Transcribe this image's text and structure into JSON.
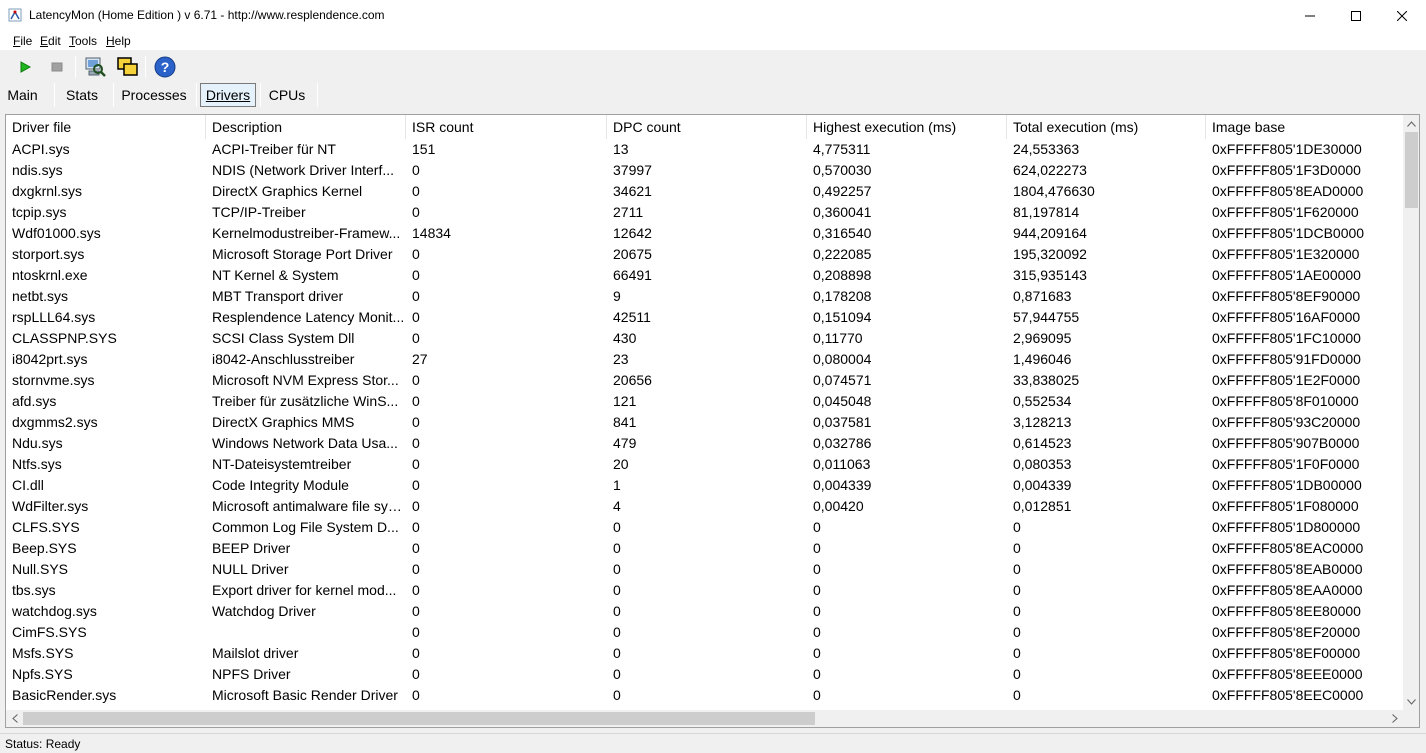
{
  "window": {
    "title": "LatencyMon  (Home Edition )  v 6.71 - http://www.resplendence.com"
  },
  "menu": [
    {
      "key": "F",
      "rest": "ile"
    },
    {
      "key": "E",
      "rest": "dit"
    },
    {
      "key": "T",
      "rest": "ools"
    },
    {
      "key": "H",
      "rest": "elp"
    }
  ],
  "toolbar": {
    "icons": [
      "play-icon",
      "stop-icon",
      "computer-search-icon",
      "windows-icon",
      "help-icon"
    ],
    "help_label": "?"
  },
  "tabs": [
    {
      "label": "Main"
    },
    {
      "label": "Stats"
    },
    {
      "label": "Processes"
    },
    {
      "label": "Drivers",
      "active": true
    },
    {
      "label": "CPUs"
    }
  ],
  "table": {
    "columns": [
      "Driver file",
      "Description",
      "ISR count",
      "DPC count",
      "Highest execution (ms)",
      "Total execution (ms)",
      "Image base"
    ],
    "rows": [
      [
        "ACPI.sys",
        "ACPI-Treiber für NT",
        "151",
        "13",
        "4,775311",
        "24,553363",
        "0xFFFFF805'1DE30000"
      ],
      [
        "ndis.sys",
        "NDIS (Network Driver Interf...",
        "0",
        "37997",
        "0,570030",
        "624,022273",
        "0xFFFFF805'1F3D0000"
      ],
      [
        "dxgkrnl.sys",
        "DirectX Graphics Kernel",
        "0",
        "34621",
        "0,492257",
        "1804,476630",
        "0xFFFFF805'8EAD0000"
      ],
      [
        "tcpip.sys",
        "TCP/IP-Treiber",
        "0",
        "2711",
        "0,360041",
        "81,197814",
        "0xFFFFF805'1F620000"
      ],
      [
        "Wdf01000.sys",
        "Kernelmodustreiber-Framew...",
        "14834",
        "12642",
        "0,316540",
        "944,209164",
        "0xFFFFF805'1DCB0000"
      ],
      [
        "storport.sys",
        "Microsoft Storage Port Driver",
        "0",
        "20675",
        "0,222085",
        "195,320092",
        "0xFFFFF805'1E320000"
      ],
      [
        "ntoskrnl.exe",
        "NT Kernel & System",
        "0",
        "66491",
        "0,208898",
        "315,935143",
        "0xFFFFF805'1AE00000"
      ],
      [
        "netbt.sys",
        "MBT Transport driver",
        "0",
        "9",
        "0,178208",
        "0,871683",
        "0xFFFFF805'8EF90000"
      ],
      [
        "rspLLL64.sys",
        "Resplendence Latency Monit...",
        "0",
        "42511",
        "0,151094",
        "57,944755",
        "0xFFFFF805'16AF0000"
      ],
      [
        "CLASSPNP.SYS",
        "SCSI Class System Dll",
        "0",
        "430",
        "0,11770",
        "2,969095",
        "0xFFFFF805'1FC10000"
      ],
      [
        "i8042prt.sys",
        "i8042-Anschlusstreiber",
        "27",
        "23",
        "0,080004",
        "1,496046",
        "0xFFFFF805'91FD0000"
      ],
      [
        "stornvme.sys",
        "Microsoft NVM Express Stor...",
        "0",
        "20656",
        "0,074571",
        "33,838025",
        "0xFFFFF805'1E2F0000"
      ],
      [
        "afd.sys",
        "Treiber für zusätzliche WinS...",
        "0",
        "121",
        "0,045048",
        "0,552534",
        "0xFFFFF805'8F010000"
      ],
      [
        "dxgmms2.sys",
        "DirectX Graphics MMS",
        "0",
        "841",
        "0,037581",
        "3,128213",
        "0xFFFFF805'93C20000"
      ],
      [
        "Ndu.sys",
        "Windows Network Data Usa...",
        "0",
        "479",
        "0,032786",
        "0,614523",
        "0xFFFFF805'907B0000"
      ],
      [
        "Ntfs.sys",
        "NT-Dateisystemtreiber",
        "0",
        "20",
        "0,011063",
        "0,080353",
        "0xFFFFF805'1F0F0000"
      ],
      [
        "CI.dll",
        "Code Integrity Module",
        "0",
        "1",
        "0,004339",
        "0,004339",
        "0xFFFFF805'1DB00000"
      ],
      [
        "WdFilter.sys",
        "Microsoft antimalware file sys...",
        "0",
        "4",
        "0,00420",
        "0,012851",
        "0xFFFFF805'1F080000"
      ],
      [
        "CLFS.SYS",
        "Common Log File System D...",
        "0",
        "0",
        "0",
        "0",
        "0xFFFFF805'1D800000"
      ],
      [
        "Beep.SYS",
        "BEEP Driver",
        "0",
        "0",
        "0",
        "0",
        "0xFFFFF805'8EAC0000"
      ],
      [
        "Null.SYS",
        "NULL Driver",
        "0",
        "0",
        "0",
        "0",
        "0xFFFFF805'8EAB0000"
      ],
      [
        "tbs.sys",
        "Export driver for kernel mod...",
        "0",
        "0",
        "0",
        "0",
        "0xFFFFF805'8EAA0000"
      ],
      [
        "watchdog.sys",
        "Watchdog Driver",
        "0",
        "0",
        "0",
        "0",
        "0xFFFFF805'8EE80000"
      ],
      [
        "CimFS.SYS",
        "",
        "0",
        "0",
        "0",
        "0",
        "0xFFFFF805'8EF20000"
      ],
      [
        "Msfs.SYS",
        "Mailslot driver",
        "0",
        "0",
        "0",
        "0",
        "0xFFFFF805'8EF00000"
      ],
      [
        "Npfs.SYS",
        "NPFS Driver",
        "0",
        "0",
        "0",
        "0",
        "0xFFFFF805'8EEE0000"
      ],
      [
        "BasicRender.sys",
        "Microsoft Basic Render Driver",
        "0",
        "0",
        "0",
        "0",
        "0xFFFFF805'8EEC0000"
      ]
    ]
  },
  "status": {
    "text": "Status: Ready"
  }
}
